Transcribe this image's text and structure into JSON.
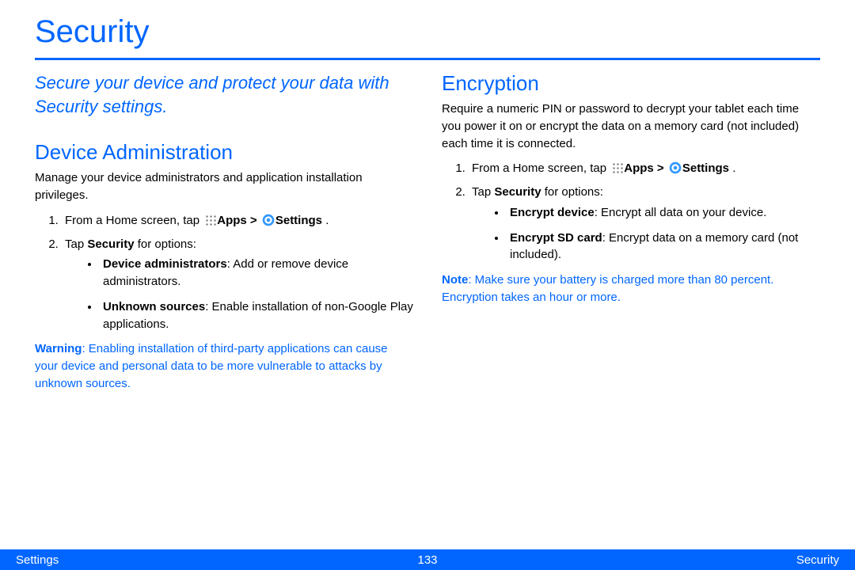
{
  "page": {
    "title": "Security",
    "tagline": "Secure your device and protect your data with Security settings."
  },
  "device_admin": {
    "heading": "Device Administration",
    "intro": "Manage your device administrators and application installation privileges.",
    "step1_prefix": "From a Home screen, tap ",
    "apps_label": "Apps > ",
    "settings_label": "Settings",
    "step1_suffix": " .",
    "step2_prefix": "Tap ",
    "step2_bold": "Security",
    "step2_suffix": " for options:",
    "bullet1_bold": "Device administrators",
    "bullet1_rest": ": Add or remove device administrators.",
    "bullet2_bold": "Unknown sources",
    "bullet2_rest": ": Enable installation of non-Google Play applications.",
    "warning_bold": "Warning",
    "warning_rest": ": Enabling installation of third-party applications can cause your device and personal data to be more vulnerable to attacks by unknown sources."
  },
  "encryption": {
    "heading": "Encryption",
    "intro": "Require a numeric PIN or password to decrypt your tablet each time you power it on or encrypt the data on a memory card (not included) each time it is connected.",
    "step1_prefix": "From a Home screen, tap ",
    "apps_label": "Apps > ",
    "settings_label": "Settings",
    "step1_suffix": " .",
    "step2_prefix": "Tap ",
    "step2_bold": "Security",
    "step2_suffix": " for options:",
    "bullet1_bold": "Encrypt device",
    "bullet1_rest": ": Encrypt all data on your device.",
    "bullet2_bold": "Encrypt SD card",
    "bullet2_rest": ": Encrypt data on a memory card (not included).",
    "note_bold": "Note",
    "note_rest": ": Make sure your battery is charged more than 80 percent. Encryption takes an hour or more."
  },
  "footer": {
    "left": "Settings",
    "center": "133",
    "right": "Security"
  }
}
